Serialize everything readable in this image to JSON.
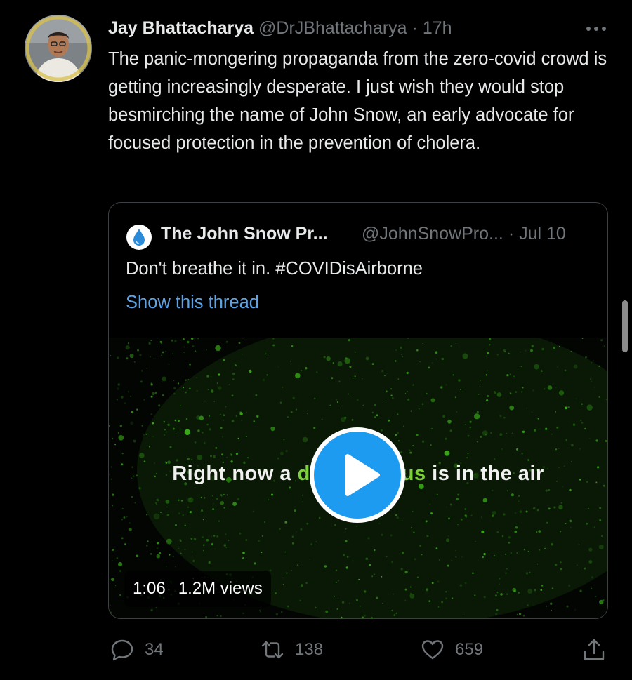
{
  "tweet": {
    "author_name": "Jay Bhattacharya",
    "author_handle": "@DrJBhattacharya",
    "separator": "·",
    "time": "17h",
    "text": "The panic-mongering propaganda from the zero-covid crowd is getting increasingly desperate. I just wish they would stop besmirching the name of John Snow, an early advocate for focused protection in the prevention of cholera.",
    "avatar_icon": "profile-photo"
  },
  "quote": {
    "author_name": "The John Snow Pr...",
    "author_handle": "@JohnSnowPro...",
    "separator": "·",
    "date": "Jul 10",
    "text": "Don't breathe it in. #COVIDisAirborne",
    "show_thread": "Show this thread",
    "logo_icon": "water-drop-icon",
    "video": {
      "caption_prefix": "Right now a ",
      "caption_green_1": "d",
      "caption_green_2": "us",
      "caption_suffix": " is in the air",
      "duration": "1:06",
      "views": "1.2M views",
      "play_icon": "play-icon"
    }
  },
  "actions": {
    "replies": "34",
    "retweets": "138",
    "likes": "659"
  },
  "colors": {
    "background": "#000000",
    "text": "#e7e9ea",
    "muted": "#71767b",
    "link": "#5ea3e6",
    "play_button": "#1d9bf0",
    "caption_accent": "#7bd137"
  }
}
